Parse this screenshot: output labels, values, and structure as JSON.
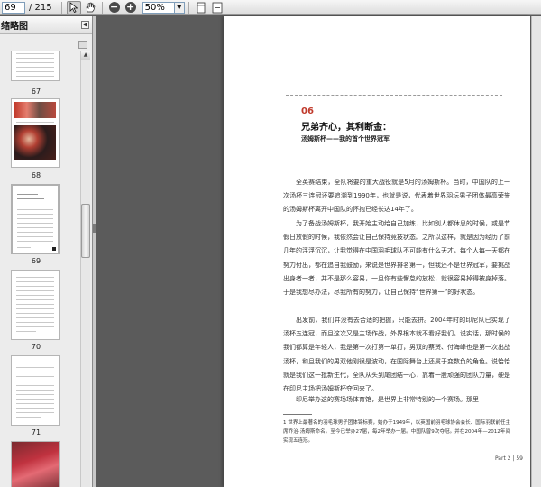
{
  "toolbar": {
    "page_current": "69",
    "page_total": "/ 215",
    "zoom_value": "50%",
    "zoom_out_symbol": "−",
    "zoom_in_symbol": "+"
  },
  "panel": {
    "title": "缩略图",
    "thumbnails": [
      {
        "label": "67"
      },
      {
        "label": "68"
      },
      {
        "label": "69"
      },
      {
        "label": "70"
      },
      {
        "label": "71"
      }
    ]
  },
  "document": {
    "chapter_number": "06",
    "chapter_title": "兄弟齐心，其利断金：",
    "chapter_subtitle": "汤姆斯杯——我的首个世界冠军",
    "paragraphs": [
      "全英赛结束，全队将要的重大战役就是5月的汤姆斯杯。当时，中国队的上一次汤杯三连冠还要追溯到1990年，也就是说，代表着世界羽坛男子团体最高荣誉的汤姆斯杯离开中国队的怀抱已经长达14年了。",
      "为了备战汤姆斯杯，我开始主动给自己加练，比如别人都休息的时候，或是节假日放假的时候，我依然会让自己保持竞技状态。之所以这样，就是因为经历了前几年的浮浮沉沉，让我觉得在中国羽毛球队不可能有什么天才，每个人每一天都在努力付出，都在追自我鼓励，来说是世界排名第一，但我还不是世界冠军，要挑战出身者一者，并不是那么容易，一旦你有些懈怠的放松，就很容易掉得被身掉落。于是我想尽办法，尽我所有的努力，让自己保持“世界第一”的好状态。",
      "出发前，我们并没有去合适的把握，只能去拼。2004年时的印尼队已实现了汤杯五连冠，而且这次又是主场作战，外界根本就不看好我们。说实话，那时候的我们都算是年轻人，我是第一次打第一单打，男双的蔡赟、付海峰也是第一次出战汤杯，和且我们的男双他刚很是波动，在国际舞台上还属于变数负的角色。说恰恰就是我们这一批新生代，全队从头到尾团结一心，靠着一股顽强的团队力量，硬是在印尼主场把汤姆斯杯夺回来了。",
      "印尼举办这的赛场场体育馆，是世界上非常特别的一个赛场。那里"
    ],
    "footnote": "1  世界上最著名的羽毛球男子团体锦标赛，始办于1949年，以英国前羽毛球协会会长、国际羽联前任主席乔治·汤姆斯命名。至今已举办27届，每2年举办一届。中国队曾9次夺冠。并在2004年—2012年间实现五连冠。",
    "folio": "Part 2 | 59"
  }
}
